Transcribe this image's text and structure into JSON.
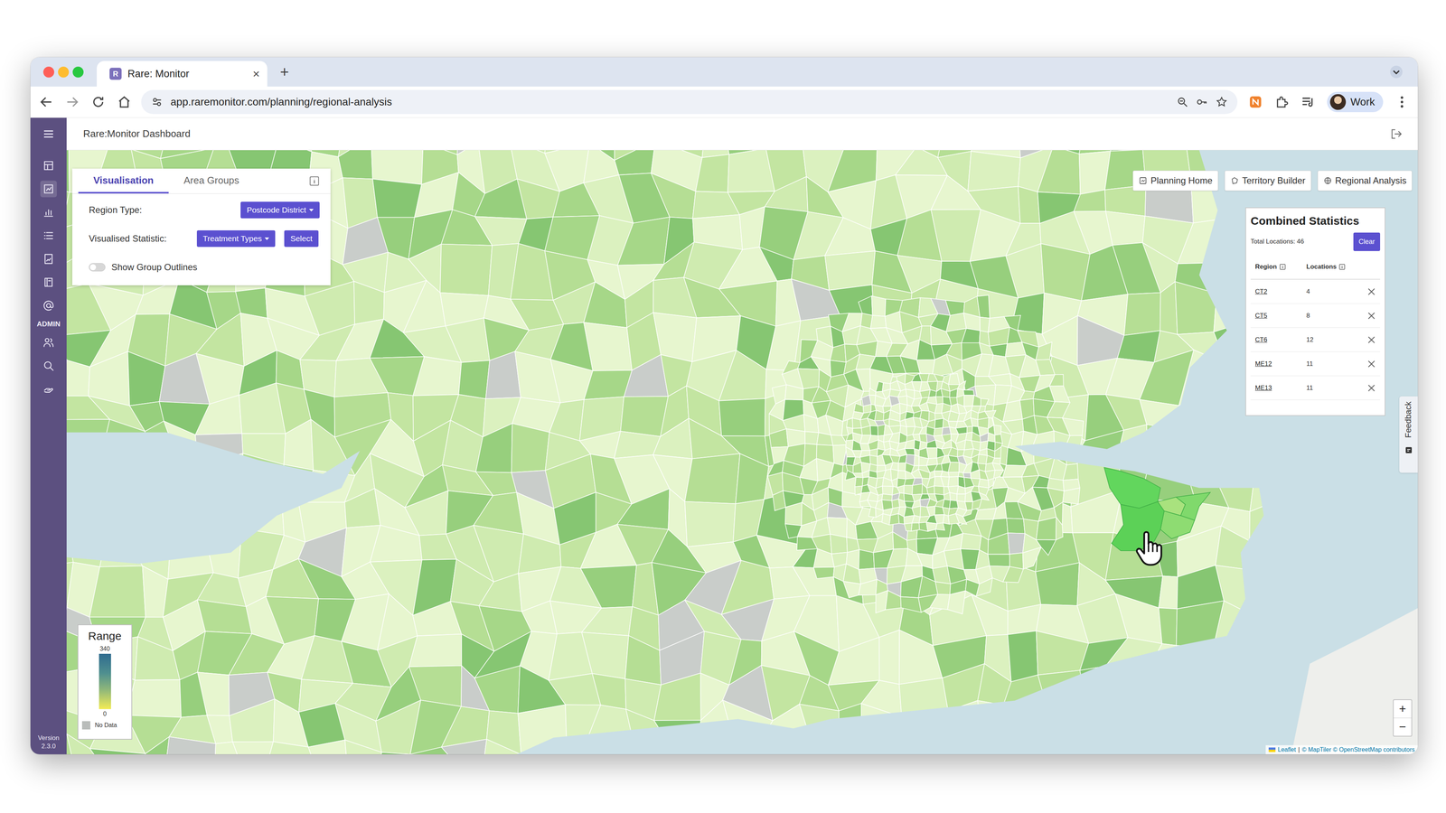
{
  "browser": {
    "tab": {
      "favicon": "R",
      "title": "Rare: Monitor",
      "close": "×"
    },
    "new_tab": "+",
    "url": "app.raremonitor.com/planning/regional-analysis",
    "profile": "Work"
  },
  "sidebar": {
    "items": [
      {
        "selected": false
      },
      {
        "selected": true
      },
      {
        "selected": false
      },
      {
        "selected": false
      },
      {
        "selected": false
      },
      {
        "selected": false
      },
      {
        "selected": false
      }
    ],
    "section_label": "ADMIN",
    "admin_items": [
      {
        "selected": false
      },
      {
        "selected": false
      },
      {
        "selected": false
      }
    ],
    "version_label": "Version",
    "version": "2.3.0"
  },
  "header": {
    "title": "Rare:Monitor Dashboard"
  },
  "controls": {
    "tabs": [
      {
        "label": "Visualisation",
        "selected": true
      },
      {
        "label": "Area Groups",
        "selected": false
      }
    ],
    "region_type": {
      "label": "Region Type:",
      "value": "Postcode District"
    },
    "statistic": {
      "label": "Visualised Statistic:",
      "value": "Treatment Types",
      "button": "Select"
    },
    "outlines": {
      "label": "Show Group Outlines",
      "on": false
    }
  },
  "nav": [
    "Planning Home",
    "Territory Builder",
    "Regional Analysis"
  ],
  "stats": {
    "title": "Combined Statistics",
    "total": "Total Locations: 46",
    "clear": "Clear",
    "columns": [
      "Region",
      "Locations"
    ],
    "rows": [
      {
        "region": "CT2",
        "locations": "4",
        "color": "#8edc72"
      },
      {
        "region": "CT5",
        "locations": "8",
        "color": "#a9e27e"
      },
      {
        "region": "CT6",
        "locations": "12",
        "color": "#80d96c"
      },
      {
        "region": "ME12",
        "locations": "11",
        "color": "#62d65d"
      },
      {
        "region": "ME13",
        "locations": "11",
        "color": "#5cd157"
      }
    ]
  },
  "legend": {
    "title": "Range",
    "max": "340",
    "min": "0",
    "no_data": "No Data"
  },
  "feedback": "Feedback",
  "zoom": [
    "+",
    "−"
  ],
  "attribution": {
    "leaflet": "Leaflet",
    "separator": "|",
    "credits": "© MapTiler © OpenStreetMap contributors"
  }
}
